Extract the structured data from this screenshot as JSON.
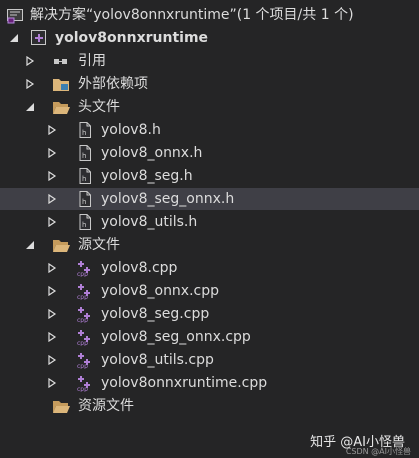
{
  "solution": {
    "label": "解决方案“yolov8onnxruntime”(1 个项目/共 1 个)"
  },
  "project": {
    "label": "yolov8onnxruntime"
  },
  "nodes": {
    "references": "引用",
    "external_deps": "外部依赖项",
    "headers": "头文件",
    "sources": "源文件",
    "resources": "资源文件"
  },
  "header_files": [
    "yolov8.h",
    "yolov8_onnx.h",
    "yolov8_seg.h",
    "yolov8_seg_onnx.h",
    "yolov8_utils.h"
  ],
  "source_files": [
    "yolov8.cpp",
    "yolov8_onnx.cpp",
    "yolov8_seg.cpp",
    "yolov8_seg_onnx.cpp",
    "yolov8_utils.cpp",
    "yolov8onnxruntime.cpp"
  ],
  "watermark": {
    "main": "知乎 @AI小怪兽",
    "sub": "CSDN @AI小怪兽"
  },
  "colors": {
    "background": "#252526",
    "selected": "#3f3f46",
    "text": "#dcdcdc",
    "folder": "#dcb67a",
    "cpp": "#b07fd6"
  }
}
